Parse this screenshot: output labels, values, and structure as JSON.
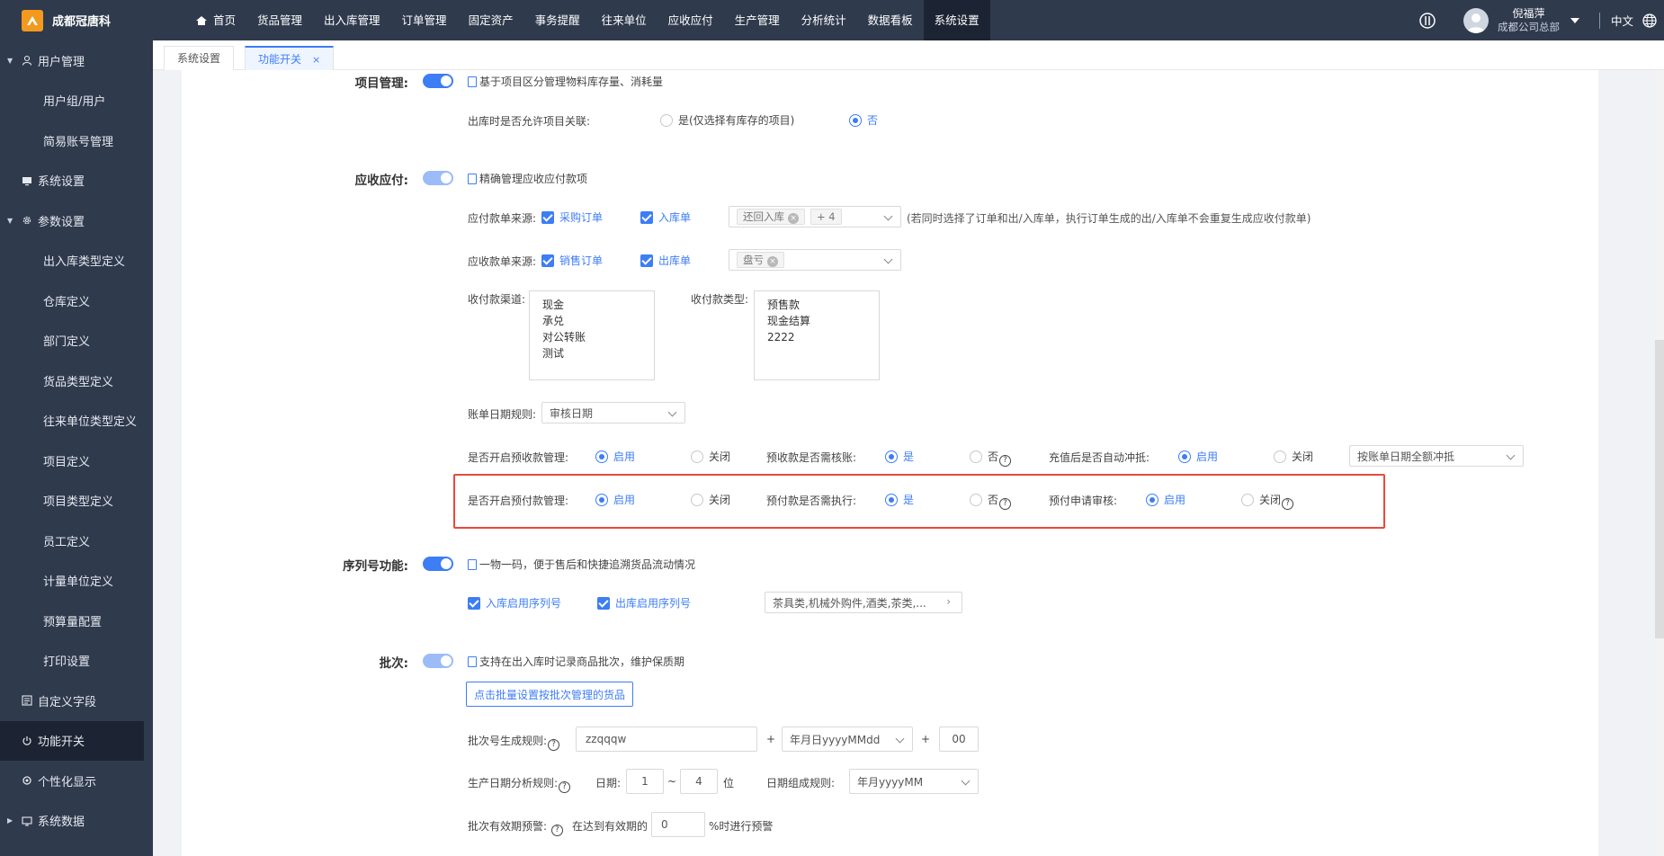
{
  "app": {
    "brand": "成都冠唐科",
    "lang": "中文"
  },
  "user": {
    "name": "倪福萍",
    "org": "成都公司总部"
  },
  "nav": [
    "首页",
    "货品管理",
    "出入库管理",
    "订单管理",
    "固定资产",
    "事务提醒",
    "往来单位",
    "应收应付",
    "生产管理",
    "分析统计",
    "数据看板",
    "系统设置"
  ],
  "sidebar": {
    "items": [
      "用户管理",
      "用户组/用户",
      "简易账号管理",
      "系统设置",
      "参数设置",
      "出入库类型定义",
      "仓库定义",
      "部门定义",
      "货品类型定义",
      "往来单位类型定义",
      "项目定义",
      "项目类型定义",
      "员工定义",
      "计量单位定义",
      "预算量配置",
      "打印设置",
      "自定义字段",
      "功能开关",
      "个性化显示",
      "系统数据"
    ]
  },
  "tabs": {
    "t1": "系统设置",
    "t2": "功能开关",
    "close": "×"
  },
  "project": {
    "title": "项目管理:",
    "desc": "基于项目区分管理物料库存量、消耗量",
    "q_label": "出库时是否允许项目关联:",
    "opt_yes": "是(仅选择有库存的项目)",
    "opt_no": "否"
  },
  "ar": {
    "title": "应收应付:",
    "desc": "精确管理应收应付款项",
    "pay_src": "应付款单来源:",
    "pay_cb1": "采购订单",
    "pay_cb2": "入库单",
    "pay_tag": "还回入库",
    "pay_more": "+ 4",
    "pay_note": "(若同时选择了订单和出/入库单，执行订单生成的出/入库单不会重复生成应收付款单)",
    "rec_src": "应收款单来源:",
    "rec_cb1": "销售订单",
    "rec_cb2": "出库单",
    "rec_tag": "盘亏",
    "channel_label": "收付款渠道:",
    "channels": [
      "现金",
      "承兑",
      "对公转账",
      "测试"
    ],
    "type_label": "收付款类型:",
    "types": [
      "预售款",
      "现金结算",
      "2222"
    ],
    "date_rule_label": "账单日期规则:",
    "date_rule": "审核日期",
    "prerec_label": "是否开启预收款管理:",
    "enable": "启用",
    "disable": "关闭",
    "prerec_audit": "预收款是否需核账:",
    "yes": "是",
    "no": "否",
    "recharge_label": "充值后是否自动冲抵:",
    "recharge_select": "按账单日期全额冲抵",
    "prepay_label": "是否开启预付款管理:",
    "prepay_exec": "预付款是否需执行:",
    "prepay_audit": "预付申请审核:",
    "q": "?"
  },
  "serial": {
    "title": "序列号功能:",
    "desc": "一物一码，便于售后和快捷追溯货品流动情况",
    "cb_in": "入库启用序列号",
    "cb_out": "出库启用序列号",
    "cats": "茶具类,机械外购件,酒类,茶类,..."
  },
  "batch": {
    "title": "批次:",
    "desc": "支持在出入库时记录商品批次，维护保质期",
    "btn": "点击批量设置按批次管理的货品",
    "rule_label": "批次号生成规则:",
    "prefix": "zzqqqw",
    "plus": "+",
    "date_fmt": "年月日yyyyMMdd",
    "suffix": "00",
    "prod_label": "生产日期分析规则:",
    "date_label": "日期:",
    "from": "1",
    "tilde": "~",
    "to": "4",
    "unit": "位",
    "compose_label": "日期组成规则:",
    "compose": "年月yyyyMM",
    "expiry_label": "批次有效期预警:",
    "expiry_pre": "在达到有效期的",
    "expiry_val": "0",
    "expiry_post": "%时进行预警"
  }
}
